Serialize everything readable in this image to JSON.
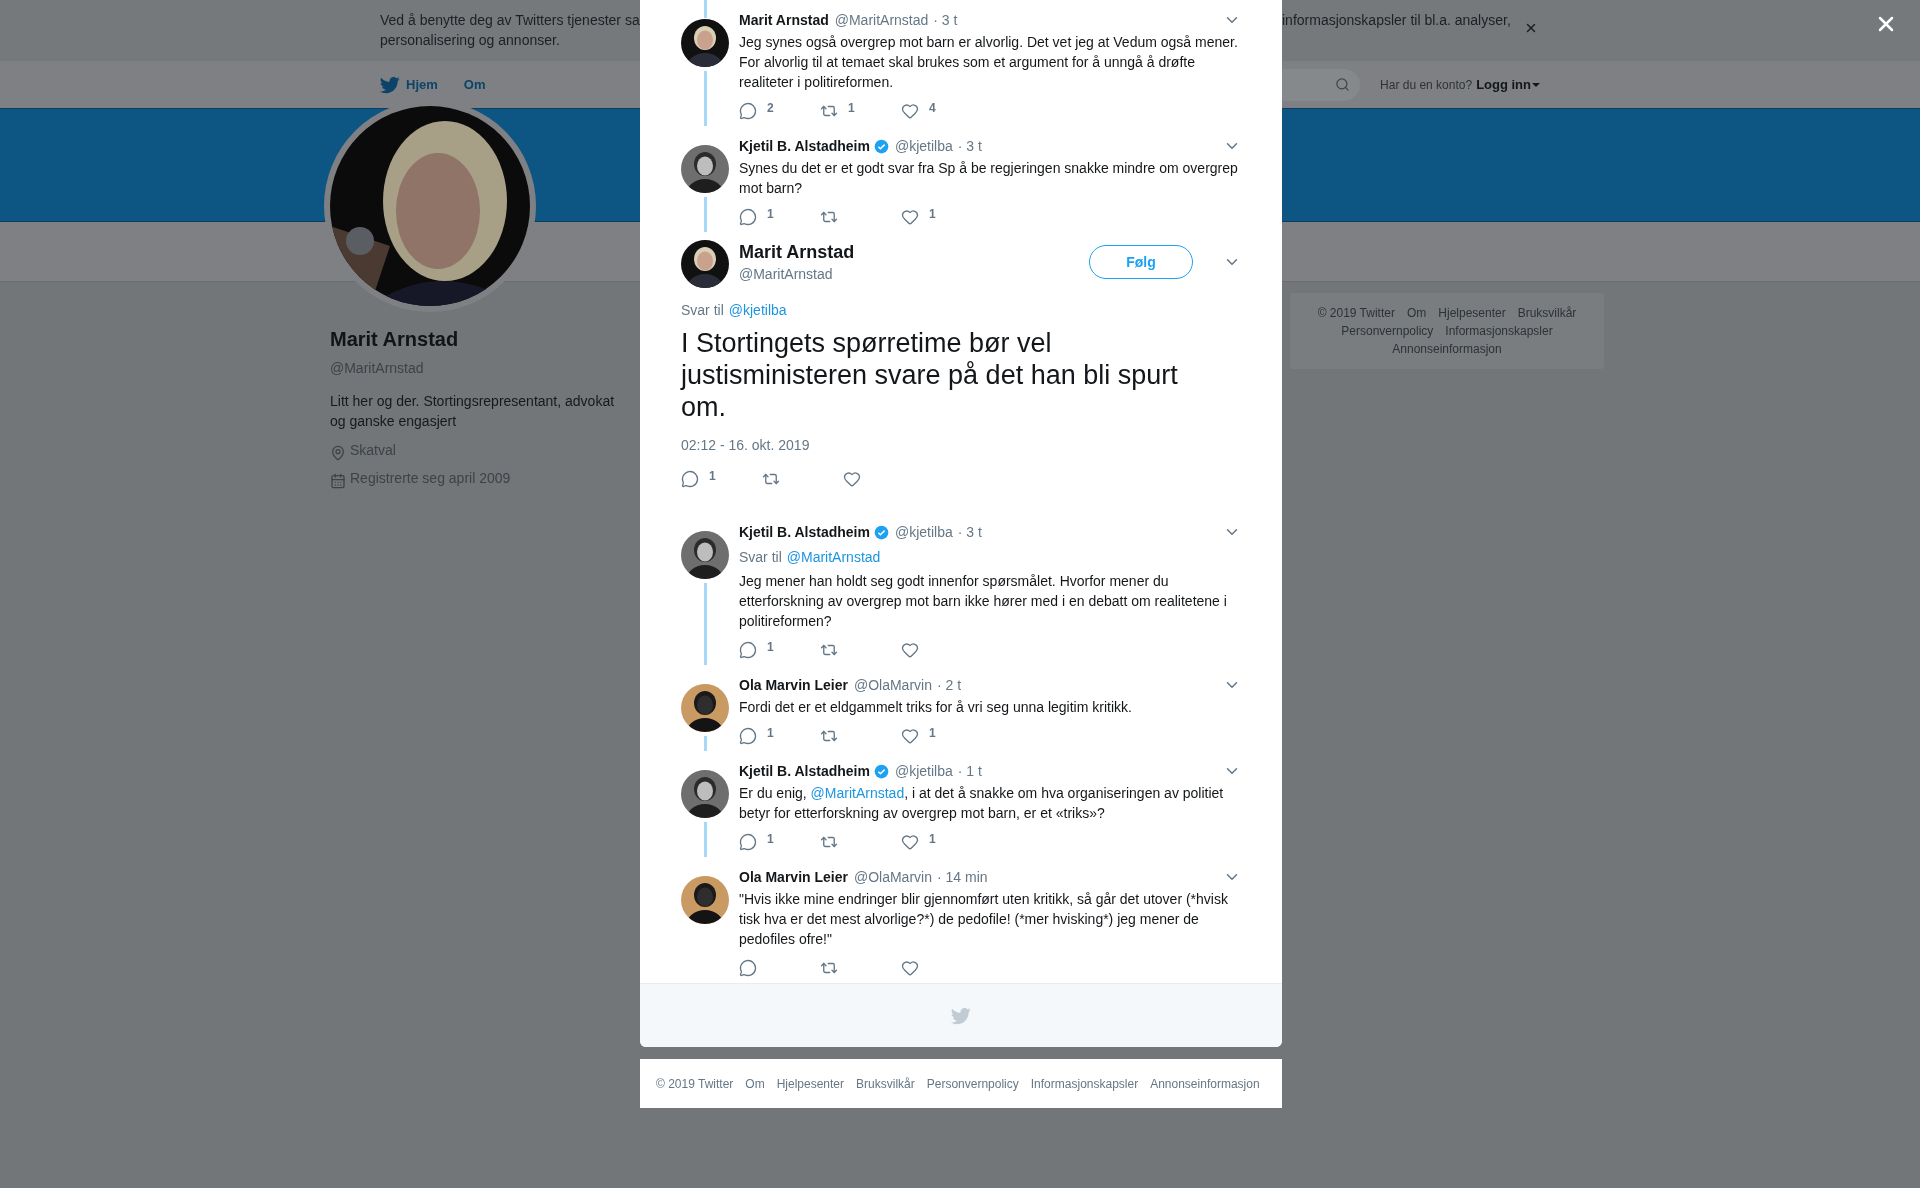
{
  "cookie_banner": {
    "lines_left": [
      "Ved å benytte deg av Twitters tjenester sa",
      "personalisering og annonser."
    ],
    "text_right": "informasjonskapsler til bl.a. analyser,"
  },
  "nav": {
    "items": [
      {
        "label": "Hjem",
        "kind": "home"
      },
      {
        "label": "Om",
        "kind": "plain"
      }
    ],
    "account_prompt": "Har du en konto?",
    "login": "Logg inn"
  },
  "profile": {
    "name": "Marit Arnstad",
    "handle": "@MaritArnstad",
    "bio": "Litt her og der. Stortingsrepresentant, advokat og ganske engasjert",
    "location": "Skatval",
    "joined": "Registrerte seg april 2009"
  },
  "side_footer": {
    "links": [
      "© 2019 Twitter",
      "Om",
      "Hjelpesenter",
      "Bruksvilkår",
      "Personvernpolicy",
      "Informasjonskapsler",
      "Annonseinformasjon"
    ]
  },
  "conversation": {
    "thread_above": [
      {
        "name": "Marit Arnstad",
        "verified": false,
        "handle": "@MaritArnstad",
        "time": "· 3 t",
        "connected_above": true,
        "connected_below": true,
        "text": [
          {
            "kind": "text",
            "value": "Jeg synes også overgrep mot barn er alvorlig. Det vet jeg at Vedum også mener. For alvorlig til at temaet skal brukes som et argument for å unngå å drøfte realiteter i politireformen."
          }
        ],
        "actions": [
          {
            "kind": "reply",
            "count": "2"
          },
          {
            "kind": "retweet",
            "count": "1"
          },
          {
            "kind": "like",
            "count": "4"
          }
        ]
      },
      {
        "name": "Kjetil B. Alstadheim",
        "verified": true,
        "handle": "@kjetilba",
        "time": "· 3 t",
        "connected_above": false,
        "connected_below": true,
        "text": [
          {
            "kind": "text",
            "value": "Synes du det er et godt svar fra Sp å be regjeringen snakke mindre om overgrep mot barn?"
          }
        ],
        "actions": [
          {
            "kind": "reply",
            "count": "1"
          },
          {
            "kind": "retweet"
          },
          {
            "kind": "like",
            "count": "1"
          }
        ]
      }
    ],
    "main_tweet": {
      "name": "Marit Arnstad",
      "handle": "@MaritArnstad",
      "follow": "Følg",
      "reply_label": "Svar til",
      "reply_handle": "@kjetilba",
      "text": "I Stortingets spørretime bør vel justisministeren svare på det han bli spurt om.",
      "timestamp": "02:12 - 16. okt. 2019",
      "actions": [
        {
          "kind": "reply",
          "count": "1"
        },
        {
          "kind": "retweet"
        },
        {
          "kind": "like"
        }
      ]
    },
    "replies": [
      {
        "name": "Kjetil B. Alstadheim",
        "verified": true,
        "handle": "@kjetilba",
        "time": "· 3 t",
        "connected_below": true,
        "reply_label": "Svar til",
        "reply_handle": "@MaritArnstad",
        "text": [
          {
            "kind": "text",
            "value": "Jeg mener han holdt seg godt innenfor spørsmålet. Hvorfor mener du etterforskning av overgrep mot barn ikke hører med i en debatt om realitetene i politireformen?"
          }
        ],
        "actions": [
          {
            "kind": "reply",
            "count": "1"
          },
          {
            "kind": "retweet"
          },
          {
            "kind": "like"
          }
        ]
      },
      {
        "name": "Ola Marvin Leier",
        "verified": false,
        "handle": "@OlaMarvin",
        "time": "· 2 t",
        "connected_below": true,
        "text": [
          {
            "kind": "text",
            "value": "Fordi det er et eldgammelt triks for å vri seg unna legitim kritikk."
          }
        ],
        "actions": [
          {
            "kind": "reply",
            "count": "1"
          },
          {
            "kind": "retweet"
          },
          {
            "kind": "like",
            "count": "1"
          }
        ]
      },
      {
        "name": "Kjetil B. Alstadheim",
        "verified": true,
        "handle": "@kjetilba",
        "time": "· 1 t",
        "connected_below": true,
        "text": [
          {
            "kind": "text",
            "value": "Er du enig, "
          },
          {
            "kind": "mention",
            "value": "@MaritArnstad"
          },
          {
            "kind": "text",
            "value": ", i at det å snakke om hva organiseringen av politiet betyr for etterforskning av overgrep mot barn, er et «triks»?"
          }
        ],
        "actions": [
          {
            "kind": "reply",
            "count": "1"
          },
          {
            "kind": "retweet"
          },
          {
            "kind": "like",
            "count": "1"
          }
        ]
      },
      {
        "name": "Ola Marvin Leier",
        "verified": false,
        "handle": "@OlaMarvin",
        "time": "· 14 min",
        "connected_below": false,
        "text": [
          {
            "kind": "text",
            "value": "\"Hvis ikke mine endringer blir gjennomført uten kritikk, så går det utover (*hvisk tisk hva er det mest alvorlige?*) de pedofile! (*mer hvisking*) jeg mener de pedofiles ofre!\""
          }
        ],
        "actions": [
          {
            "kind": "reply"
          },
          {
            "kind": "retweet"
          },
          {
            "kind": "like"
          }
        ]
      }
    ]
  },
  "bottom_footer": {
    "links": [
      "© 2019 Twitter",
      "Om",
      "Hjelpesenter",
      "Bruksvilkår",
      "Personvernpolicy",
      "Informasjonskapsler",
      "Annonseinformasjon"
    ]
  }
}
